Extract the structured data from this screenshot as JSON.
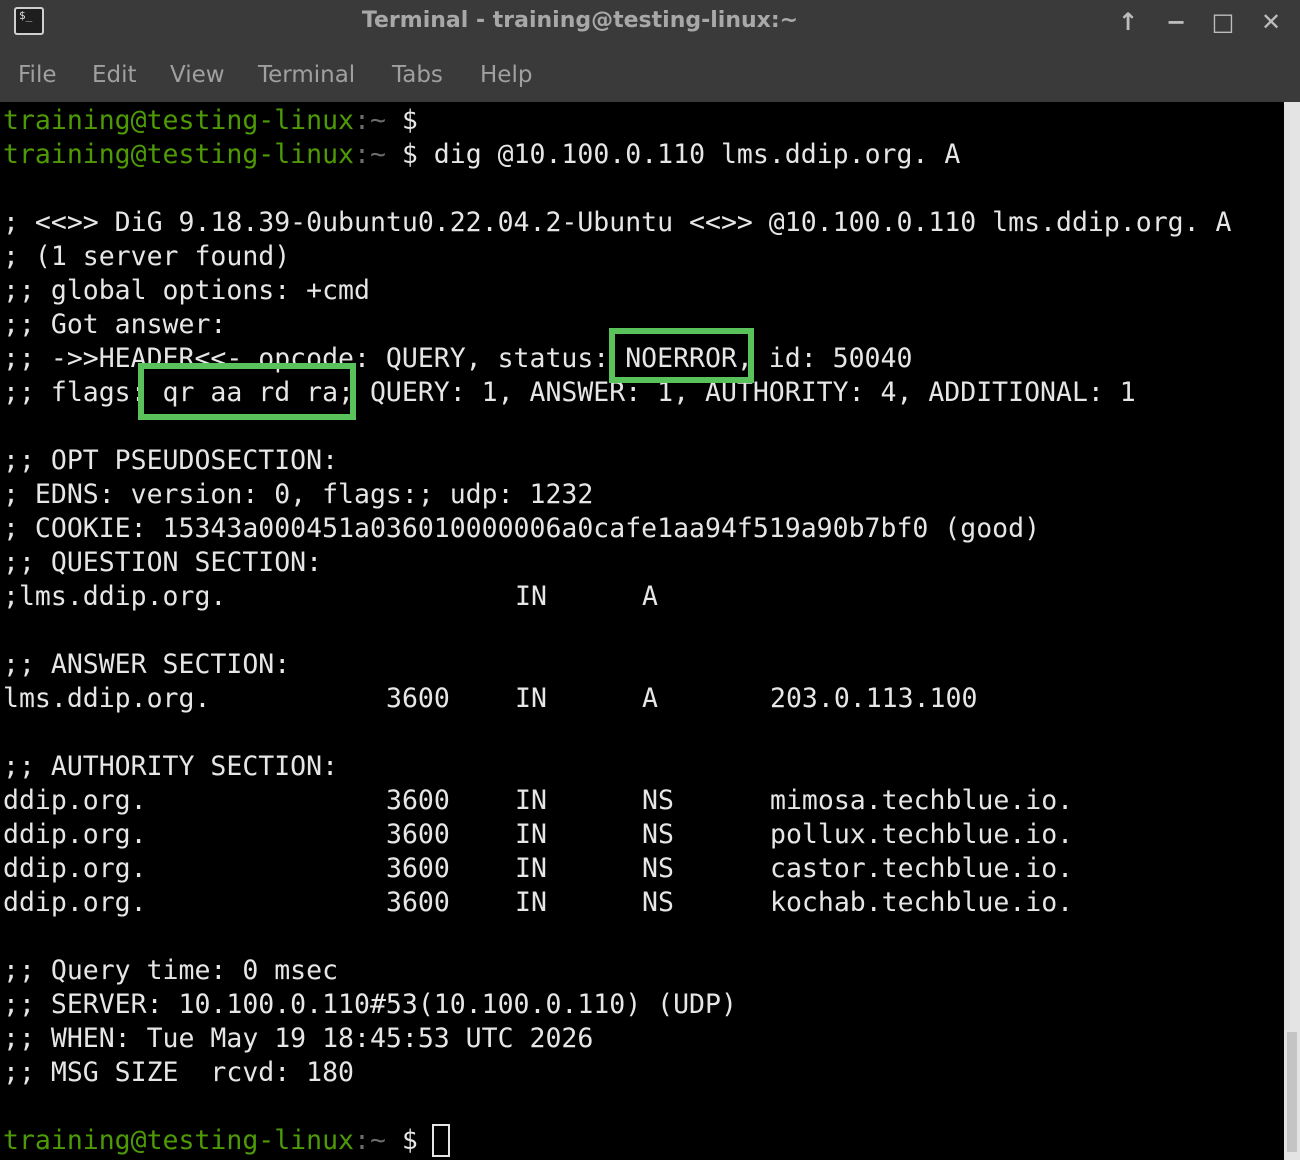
{
  "window": {
    "title": "Terminal - training@testing-linux:~",
    "app_icon_glyph": "$_",
    "controls": {
      "up_icon": "↑",
      "minimize_icon": "−",
      "maximize_icon": "□",
      "close_icon": "✕"
    }
  },
  "menu": {
    "file": "File",
    "edit": "Edit",
    "view": "View",
    "terminal": "Terminal",
    "tabs": "Tabs",
    "help": "Help"
  },
  "prompt": {
    "user_host": "training@testing-linux",
    "path": ":~",
    "symbol": " $"
  },
  "commands": {
    "first": "",
    "second": " dig @10.100.0.110 lms.ddip.org. A"
  },
  "output": {
    "banner": "; <<>> DiG 9.18.39-0ubuntu0.22.04.2-Ubuntu <<>> @10.100.0.110 lms.ddip.org. A",
    "server_found": "; (1 server found)",
    "global_options": ";; global options: +cmd",
    "got_answer": ";; Got answer:",
    "header": ";; ->>HEADER<<- opcode: QUERY, status: NOERROR, id: 50040",
    "flags": ";; flags: qr aa rd ra; QUERY: 1, ANSWER: 1, AUTHORITY: 4, ADDITIONAL: 1",
    "opt_heading": ";; OPT PSEUDOSECTION:",
    "edns": "; EDNS: version: 0, flags:; udp: 1232",
    "cookie": "; COOKIE: 15343a000451a036010000006a0cafe1aa94f519a90b7bf0 (good)",
    "question_heading": ";; QUESTION SECTION:",
    "question": {
      "name": ";lms.ddip.org.",
      "class": "IN",
      "type": "A"
    },
    "answer_heading": ";; ANSWER SECTION:",
    "answer": {
      "name": "lms.ddip.org.",
      "ttl": "3600",
      "class": "IN",
      "type": "A",
      "data": "203.0.113.100"
    },
    "authority_heading": ";; AUTHORITY SECTION:",
    "authority": [
      {
        "name": "ddip.org.",
        "ttl": "3600",
        "class": "IN",
        "type": "NS",
        "data": "mimosa.techblue.io."
      },
      {
        "name": "ddip.org.",
        "ttl": "3600",
        "class": "IN",
        "type": "NS",
        "data": "pollux.techblue.io."
      },
      {
        "name": "ddip.org.",
        "ttl": "3600",
        "class": "IN",
        "type": "NS",
        "data": "castor.techblue.io."
      },
      {
        "name": "ddip.org.",
        "ttl": "3600",
        "class": "IN",
        "type": "NS",
        "data": "kochab.techblue.io."
      }
    ],
    "query_time": ";; Query time: 0 msec",
    "server": ";; SERVER: 10.100.0.110#53(10.100.0.110) (UDP)",
    "when": ";; WHEN: Tue May 19 18:45:53 UTC 2026",
    "msg_size": ";; MSG SIZE  rcvd: 180"
  },
  "annotations": {
    "highlight_color": "#59c25a",
    "status_box_label": "NOERROR status highlight",
    "flags_box_label": "flags qr aa rd ra highlight"
  },
  "colors": {
    "prompt_user": "#4e9a06",
    "prompt_path": "#6b6b6b",
    "text": "#e6e6e6",
    "background": "#000000",
    "titlebar": "#3a3a3a"
  }
}
